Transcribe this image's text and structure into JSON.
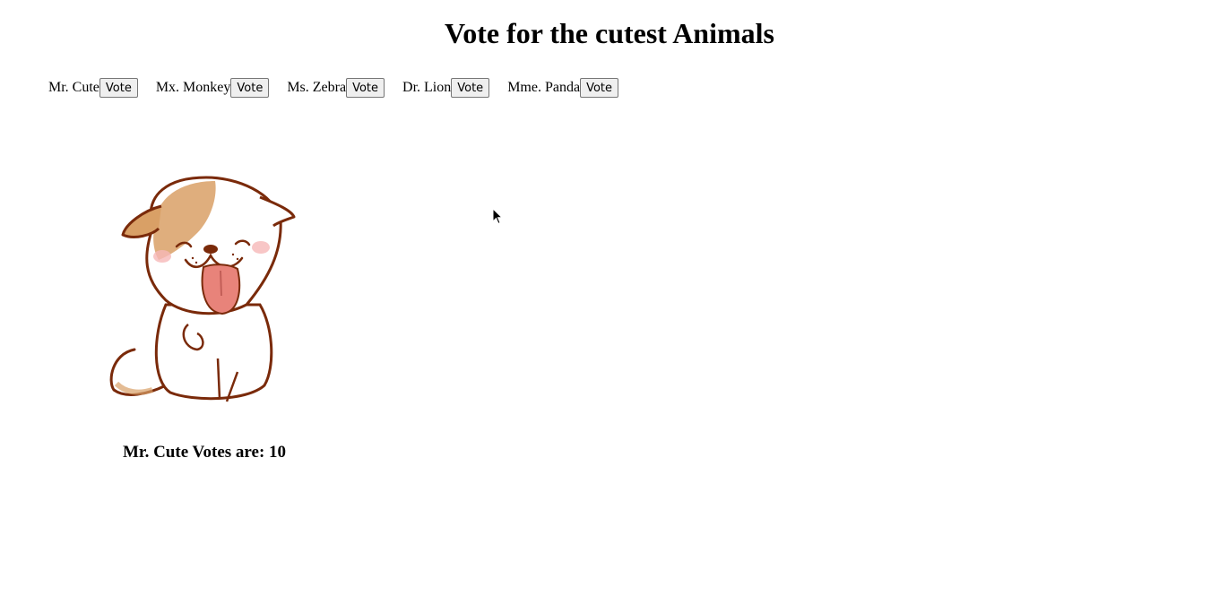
{
  "page": {
    "title": "Vote for the cutest Animals"
  },
  "candidates": [
    {
      "name": "Mr. Cute",
      "button_label": "Vote"
    },
    {
      "name": "Mx. Monkey",
      "button_label": "Vote"
    },
    {
      "name": "Ms. Zebra",
      "button_label": "Vote"
    },
    {
      "name": "Dr. Lion",
      "button_label": "Vote"
    },
    {
      "name": "Mme. Panda",
      "button_label": "Vote"
    }
  ],
  "selected": {
    "image_icon": "cartoon-puppy-icon",
    "votes_text": "Mr. Cute Votes are: 10"
  },
  "colors": {
    "outline": "#7a2a0a",
    "fur_patch": "#d9a066",
    "tongue": "#e8837a",
    "blush": "#f6b8b8"
  }
}
